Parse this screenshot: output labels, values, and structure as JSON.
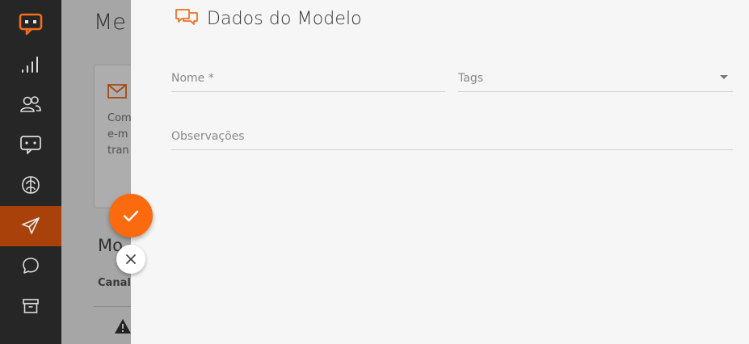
{
  "colors": {
    "accent": "#fb6a0e",
    "sidebar_bg": "#262626",
    "sidebar_active": "#a8420a",
    "drawer_bg": "#f6f6f6"
  },
  "sidebar": {
    "items": [
      {
        "icon": "chat-logo-icon",
        "active": false
      },
      {
        "icon": "signal-bars-icon",
        "active": false
      },
      {
        "icon": "users-icon",
        "active": false
      },
      {
        "icon": "chatbot-icon",
        "active": false
      },
      {
        "icon": "brain-icon",
        "active": false
      },
      {
        "icon": "send-icon",
        "active": true
      },
      {
        "icon": "chat-bubble-icon",
        "active": false
      },
      {
        "icon": "archive-icon",
        "active": false
      }
    ]
  },
  "background": {
    "title": "Me",
    "card_text": "Com\ne-m\ntran",
    "section_title": "Mo",
    "column_header": "Canal"
  },
  "drawer": {
    "title": "Dados do Modelo",
    "fields": {
      "nome": {
        "label": "Nome *",
        "value": ""
      },
      "tags": {
        "label": "Tags",
        "value": ""
      },
      "observacoes": {
        "label": "Observações",
        "value": ""
      }
    }
  },
  "actions": {
    "confirm_icon": "check-icon",
    "cancel_icon": "close-icon"
  }
}
